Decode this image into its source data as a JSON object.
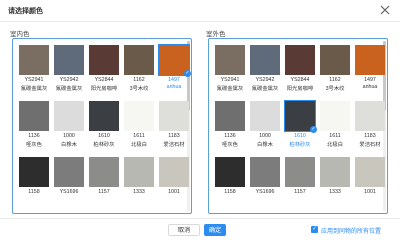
{
  "dialog": {
    "title": "请选择颜色",
    "close_icon": "close-icon"
  },
  "accent_color": "#2d8cf0",
  "interior": {
    "label": "室内色",
    "swatches": [
      {
        "code": "YS2941",
        "name": "氟碳金属灰",
        "color": "#7a6d61",
        "selected": false
      },
      {
        "code": "YS2942",
        "name": "氟碳金属灰",
        "color": "#5f6a7a",
        "selected": false
      },
      {
        "code": "YS2844",
        "name": "阳光房咖啡",
        "color": "#5a3a34",
        "selected": false
      },
      {
        "code": "1162",
        "name": "3号木纹",
        "color": "#6a5a4a",
        "selected": false
      },
      {
        "code": "1497",
        "name": "anhua",
        "color": "#c8621e",
        "selected": true
      },
      {
        "code": "1136",
        "name": "哑灰色",
        "color": "#6f6f6f",
        "selected": false
      },
      {
        "code": "1000",
        "name": "白橡木",
        "color": "#dcdcdc",
        "selected": false
      },
      {
        "code": "1610",
        "name": "柏林砂灰",
        "color": "#3b3e43",
        "selected": false
      },
      {
        "code": "1611",
        "name": "北极白",
        "color": "#f6f6f2",
        "selected": false
      },
      {
        "code": "1183",
        "name": "爱洁石材",
        "color": "#dededa",
        "selected": false
      },
      {
        "code": "1158",
        "name": "",
        "color": "#2d2d2d",
        "selected": false
      },
      {
        "code": "YS1696",
        "name": "",
        "color": "#7c7c7c",
        "selected": false
      },
      {
        "code": "1157",
        "name": "",
        "color": "#8c8c8a",
        "selected": false
      },
      {
        "code": "1333",
        "name": "",
        "color": "#b8b8b2",
        "selected": false
      },
      {
        "code": "1001",
        "name": "",
        "color": "#c9c6be",
        "selected": false
      }
    ]
  },
  "exterior": {
    "label": "室外色",
    "swatches": [
      {
        "code": "YS2941",
        "name": "氟碳金属灰",
        "color": "#7a6d61",
        "selected": false
      },
      {
        "code": "YS2942",
        "name": "氟碳金属灰",
        "color": "#5f6a7a",
        "selected": false
      },
      {
        "code": "YS2844",
        "name": "阳光房咖啡",
        "color": "#5a3a34",
        "selected": false
      },
      {
        "code": "1162",
        "name": "3号木纹",
        "color": "#6a5a4a",
        "selected": false
      },
      {
        "code": "1497",
        "name": "anhua",
        "color": "#c8621e",
        "selected": false
      },
      {
        "code": "1136",
        "name": "哑灰色",
        "color": "#6f6f6f",
        "selected": false
      },
      {
        "code": "1000",
        "name": "白橡木",
        "color": "#dcdcdc",
        "selected": false
      },
      {
        "code": "1610",
        "name": "柏林砂灰",
        "color": "#3b3e43",
        "selected": true
      },
      {
        "code": "1611",
        "name": "北极白",
        "color": "#f6f6f2",
        "selected": false
      },
      {
        "code": "1183",
        "name": "爱洁石材",
        "color": "#dededa",
        "selected": false
      },
      {
        "code": "1158",
        "name": "",
        "color": "#2d2d2d",
        "selected": false
      },
      {
        "code": "YS1696",
        "name": "",
        "color": "#7c7c7c",
        "selected": false
      },
      {
        "code": "1157",
        "name": "",
        "color": "#8c8c8a",
        "selected": false
      },
      {
        "code": "1333",
        "name": "",
        "color": "#b8b8b2",
        "selected": false
      },
      {
        "code": "1001",
        "name": "",
        "color": "#c9c6be",
        "selected": false
      }
    ]
  },
  "footer": {
    "cancel_label": "取消",
    "ok_label": "确定",
    "apply_all_label": "应用到同物的所有位置",
    "apply_all_checked": true
  }
}
